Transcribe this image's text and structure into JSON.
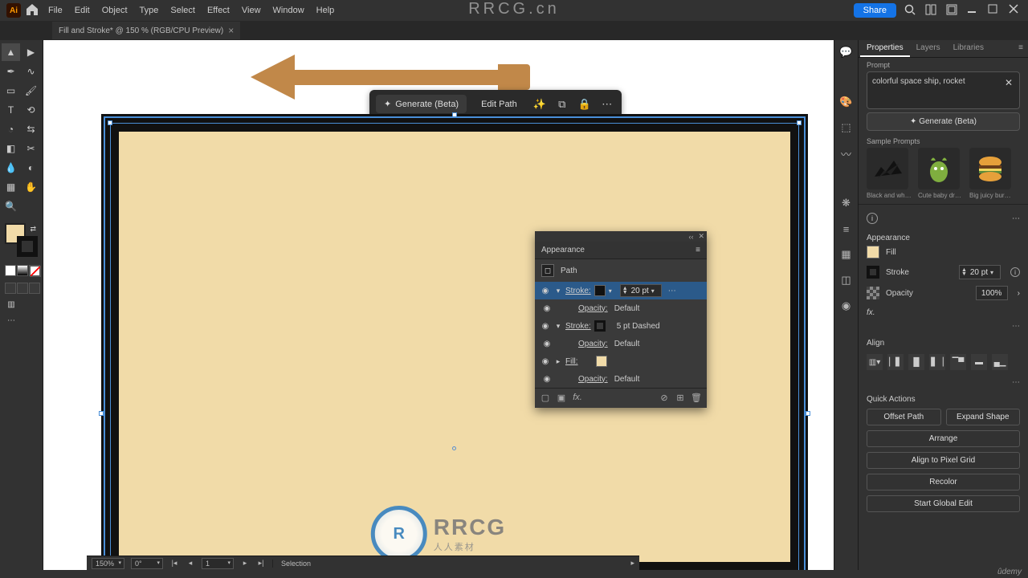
{
  "menubar": {
    "items": [
      "File",
      "Edit",
      "Object",
      "Type",
      "Select",
      "Effect",
      "View",
      "Window",
      "Help"
    ],
    "share": "Share"
  },
  "tab": {
    "title": "Fill and Stroke* @ 150 % (RGB/CPU Preview)"
  },
  "ctx": {
    "generate": "Generate (Beta)",
    "editpath": "Edit Path"
  },
  "appearance_panel": {
    "title": "Appearance",
    "target": "Path",
    "rows": {
      "stroke1": {
        "label": "Stroke:",
        "val": "20 pt",
        "opacity_lbl": "Opacity:",
        "opacity_val": "Default"
      },
      "stroke2": {
        "label": "Stroke:",
        "val": "5 pt Dashed",
        "opacity_lbl": "Opacity:",
        "opacity_val": "Default"
      },
      "fill": {
        "label": "Fill:",
        "opacity_lbl": "Opacity:",
        "opacity_val": "Default"
      }
    }
  },
  "props": {
    "tabs": [
      "Properties",
      "Layers",
      "Libraries"
    ],
    "prompt_label": "Prompt",
    "prompt_text": "colorful space ship, rocket",
    "gen_btn": "Generate (Beta)",
    "samples_label": "Sample Prompts",
    "samples": [
      {
        "caption": "Black and white..."
      },
      {
        "caption": "Cute baby drag..."
      },
      {
        "caption": "Big juicy burger..."
      }
    ],
    "appearance_label": "Appearance",
    "fill_label": "Fill",
    "stroke_label": "Stroke",
    "stroke_val": "20 pt",
    "opacity_label": "Opacity",
    "opacity_val": "100%",
    "align_label": "Align",
    "qa_label": "Quick Actions",
    "qa": {
      "offset": "Offset Path",
      "expand": "Expand Shape",
      "arrange": "Arrange",
      "pixelgrid": "Align to Pixel Grid",
      "recolor": "Recolor",
      "globaledit": "Start Global Edit"
    }
  },
  "status": {
    "zoom": "150%",
    "rotate": "0°",
    "page": "1",
    "sel": "Selection"
  },
  "watermark": {
    "top": "RRCG.cn"
  }
}
